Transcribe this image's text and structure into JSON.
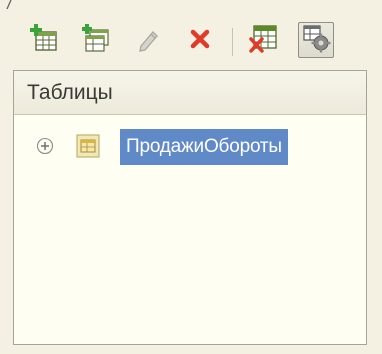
{
  "toolbar": {
    "buttons": [
      {
        "name": "add-table-button",
        "icon": "add-table-icon"
      },
      {
        "name": "add-copy-button",
        "icon": "add-copy-icon"
      },
      {
        "name": "edit-button",
        "icon": "pencil-icon"
      },
      {
        "name": "delete-button",
        "icon": "delete-icon"
      },
      {
        "name": "excel-export-button",
        "icon": "excel-x-icon"
      },
      {
        "name": "settings-table-button",
        "icon": "table-gear-icon",
        "pressed": true
      }
    ]
  },
  "panel": {
    "header": "Таблицы",
    "tree": [
      {
        "label": "ПродажиОбороты",
        "expanded": false,
        "selected": true,
        "icon": "register-table-icon"
      }
    ]
  },
  "colors": {
    "background": "#f4f1e3",
    "panel_background": "#fffef3",
    "selection": "#5f89c7",
    "delete_red": "#e23a2a",
    "add_green": "#3aa33a"
  }
}
